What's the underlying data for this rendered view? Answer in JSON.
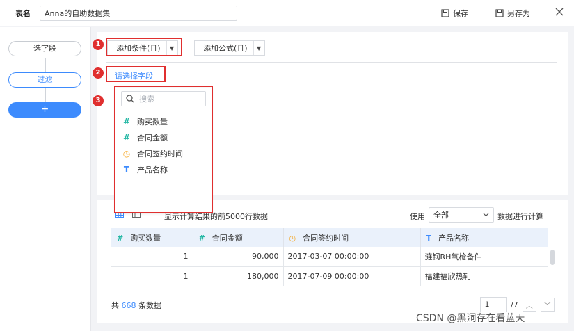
{
  "header": {
    "table_name_label": "表名",
    "table_name_value": "Anna的自助数据集",
    "save_label": "保存",
    "save_as_label": "另存为"
  },
  "sidebar": {
    "steps": [
      {
        "label": "选字段"
      },
      {
        "label": "过滤"
      },
      {
        "label": "+"
      }
    ]
  },
  "filter": {
    "add_condition_label": "添加条件(且)",
    "add_formula_label": "添加公式(且)",
    "select_field_label": "请选择字段"
  },
  "dropdown": {
    "search_placeholder": "搜索",
    "fields": [
      {
        "icon": "#",
        "icon_name": "number-icon",
        "label": "购买数量"
      },
      {
        "icon": "#",
        "icon_name": "number-icon",
        "label": "合同金额"
      },
      {
        "icon": "◷",
        "icon_name": "clock-icon",
        "label": "合同签约时间"
      },
      {
        "icon": "T",
        "icon_name": "text-icon",
        "label": "产品名称"
      }
    ]
  },
  "annotations": {
    "badges": [
      "1",
      "2",
      "3"
    ],
    "color": "#e02f2f"
  },
  "preview": {
    "info_text": "显示计算结果的前5000行数据",
    "use_label": "使用",
    "use_value": "全部",
    "use_suffix": "数据进行计算",
    "columns": [
      {
        "icon": "#",
        "label": "购买数量"
      },
      {
        "icon": "#",
        "label": "合同金额"
      },
      {
        "icon": "◷",
        "label": "合同签约时间"
      },
      {
        "icon": "T",
        "label": "产品名称"
      }
    ],
    "rows": [
      [
        "1",
        "90,000",
        "2017-03-07 00:00:00",
        "涟钢RH氧枪备件"
      ],
      [
        "1",
        "180,000",
        "2017-07-09 00:00:00",
        "福建福欣热轧"
      ]
    ],
    "total_prefix": "共",
    "total_count": "668",
    "total_suffix": "条数据",
    "page_value": "1",
    "page_total": "/7"
  },
  "watermark": "CSDN @黑洞存在看蓝天",
  "colors": {
    "accent": "#3d8bfd",
    "number_icon": "#23b7a4",
    "date_icon": "#f5a623"
  }
}
